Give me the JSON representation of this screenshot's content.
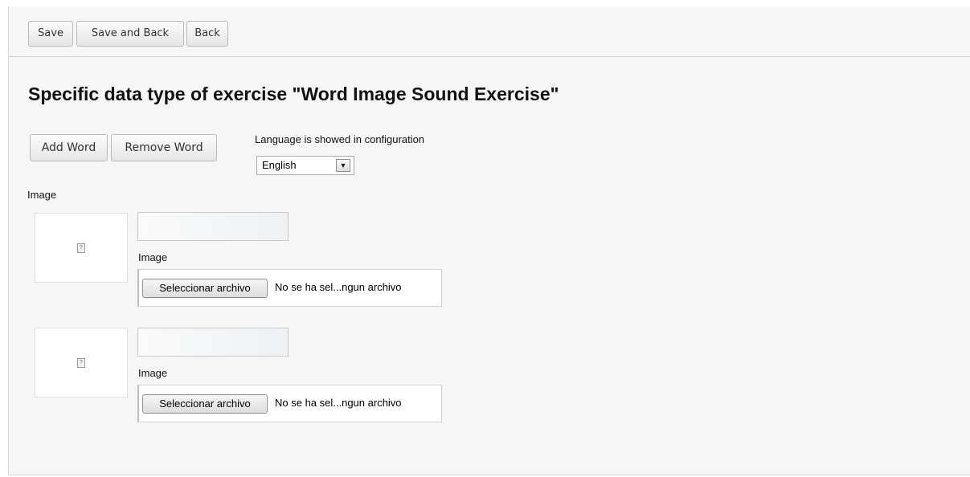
{
  "toolbar": {
    "save": "Save",
    "save_and_back": "Save and Back",
    "back": "Back"
  },
  "page_title": "Specific data type of exercise \"Word Image Sound Exercise\"",
  "actions": {
    "add_word": "Add Word",
    "remove_word": "Remove Word"
  },
  "language": {
    "label": "Language is showed in configuration",
    "selected": "English"
  },
  "image_heading": "Image",
  "words": [
    {
      "word_value": "",
      "image_label": "Image",
      "file_button": "Seleccionar archivo",
      "file_status": "No se ha sel...ngun archivo"
    },
    {
      "word_value": "",
      "image_label": "Image",
      "file_button": "Seleccionar archivo",
      "file_status": "No se ha sel...ngun archivo"
    }
  ]
}
